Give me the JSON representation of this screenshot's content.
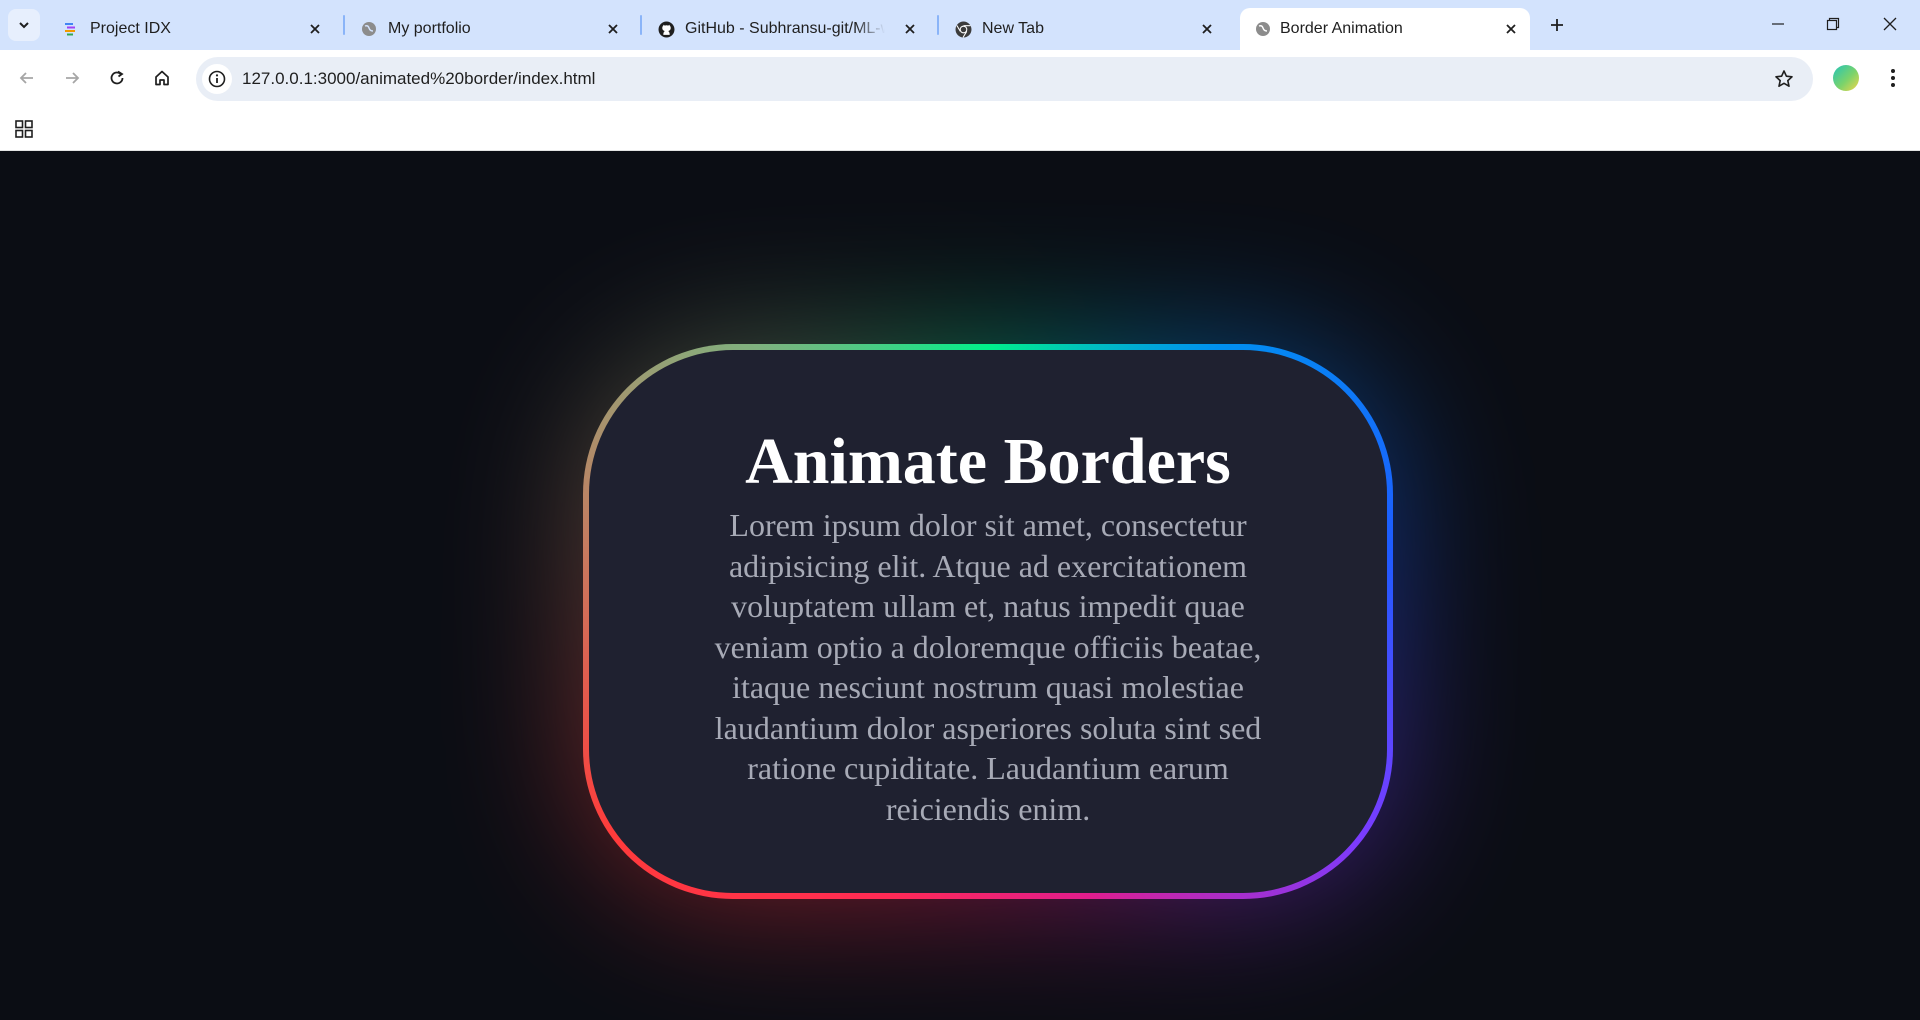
{
  "browser": {
    "tabs": [
      {
        "title": "Project IDX",
        "icon": "project-idx-icon",
        "active": false
      },
      {
        "title": "My portfolio",
        "icon": "globe-icon",
        "active": false
      },
      {
        "title": "GitHub - Subhransu-git/ML-with",
        "icon": "github-icon",
        "active": false
      },
      {
        "title": "New Tab",
        "icon": "chrome-icon",
        "active": false
      },
      {
        "title": "Border Animation",
        "icon": "globe-icon",
        "active": true
      }
    ],
    "url": "127.0.0.1:3000/animated%20border/index.html"
  },
  "page": {
    "title": "Animate Borders",
    "body": "Lorem ipsum dolor sit amet, consectetur adipisicing elit. Atque ad exercitationem voluptatem ullam et, natus impedit quae veniam optio a doloremque officiis beatae, itaque nesciunt nostrum quasi molestiae laudantium dolor asperiores soluta sint sed ratione cupiditate. Laudantium earum reiciendis enim."
  },
  "colors": {
    "tabstrip_bg": "#d3e3fd",
    "page_bg": "#0b0d14",
    "card_bg": "#1f2130",
    "border_gradient": [
      "#00f08a",
      "#0090f0",
      "#1f5bff",
      "#7a3cff",
      "#e11d8c",
      "#ff2a55",
      "#c77a5f",
      "#7fb27f"
    ]
  }
}
